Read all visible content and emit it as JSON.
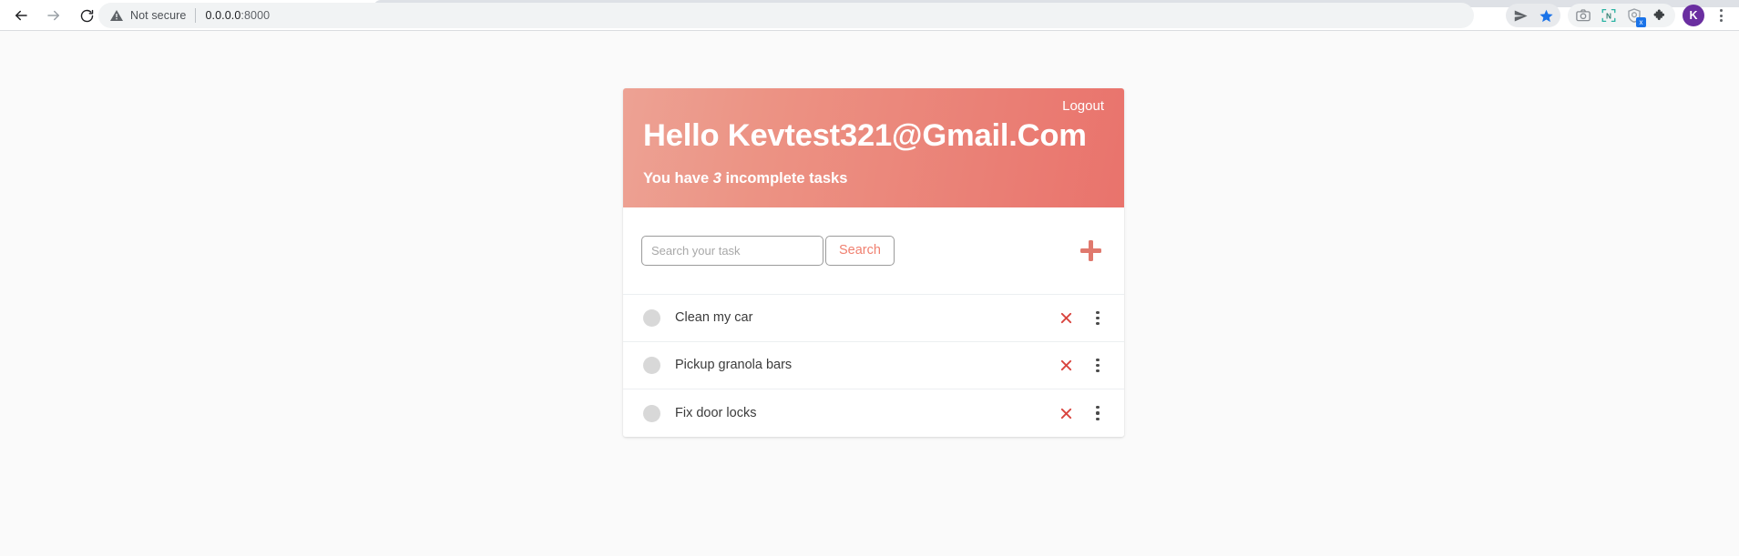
{
  "browser": {
    "back_label": "Back",
    "forward_label": "Forward",
    "reload_label": "Reload",
    "security_label": "Not secure",
    "url": "0.0.0.0:8000",
    "url_host": "0.0.0.0",
    "url_port": ":8000",
    "icons": {
      "back": "back-arrow-icon",
      "forward": "forward-arrow-icon",
      "reload": "reload-icon",
      "warning": "warning-triangle-icon",
      "send": "send-paper-plane-icon",
      "bookmark": "star-icon",
      "screenshot": "camera-icon",
      "notion": "notion-clipper-icon",
      "shield": "shield-extension-icon",
      "extensions": "puzzle-piece-icon",
      "menu": "three-dot-menu-icon"
    },
    "profile_initial": "K",
    "badge_text": "x"
  },
  "app": {
    "header": {
      "logout_label": "Logout",
      "greeting": "Hello Kevtest321@Gmail.Com",
      "subtitle_prefix": "You have ",
      "incomplete_count": "3",
      "subtitle_suffix": " incomplete tasks",
      "gradient_from": "#eda294",
      "gradient_to": "#e9736c"
    },
    "search": {
      "placeholder": "Search your task",
      "value": "",
      "button_label": "Search",
      "button_color": "#f08070",
      "add_button_label": "+",
      "add_button_color": "#e0796e"
    },
    "tasks": [
      {
        "label": "Clean my car",
        "completed": false,
        "delete_label": "Delete",
        "menu_label": "More options"
      },
      {
        "label": "Pickup granola bars",
        "completed": false,
        "delete_label": "Delete",
        "menu_label": "More options"
      },
      {
        "label": "Fix door locks",
        "completed": false,
        "delete_label": "Delete",
        "menu_label": "More options"
      }
    ],
    "colors": {
      "delete_icon": "#d9453f",
      "task_circle": "#d8d8d8",
      "page_background": "#fafafa"
    }
  }
}
